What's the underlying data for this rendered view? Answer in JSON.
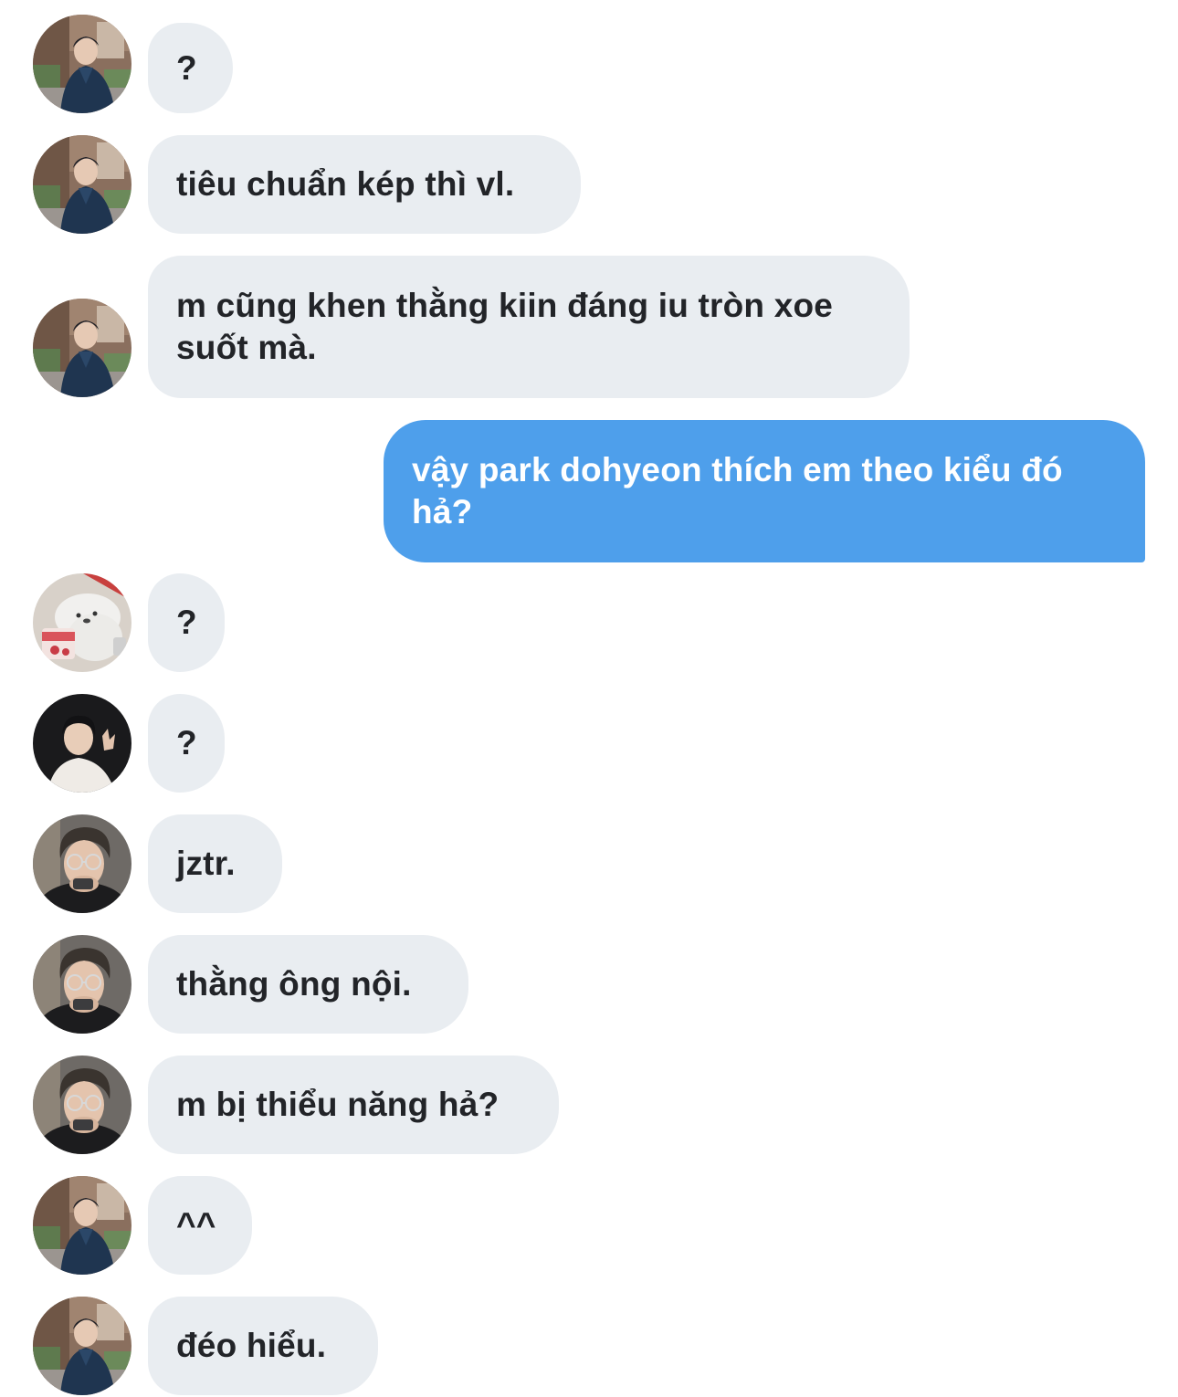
{
  "colors": {
    "incoming_bubble": "#e9edf1",
    "outgoing_bubble": "#4e9feb",
    "incoming_text": "#222428",
    "outgoing_text": "#ffffff",
    "background": "#ffffff"
  },
  "messages": [
    {
      "sender": "them",
      "avatar": "avatar-man-street",
      "text": "?"
    },
    {
      "sender": "them",
      "avatar": "avatar-man-street",
      "text": "tiêu chuẩn kép thì vl."
    },
    {
      "sender": "them",
      "avatar": "avatar-man-street",
      "text": "m cũng khen thằng kiin đáng iu tròn xoe\nsuốt mà."
    },
    {
      "sender": "me",
      "text": "vậy park dohyeon thích em theo kiểu đó\nhả?"
    },
    {
      "sender": "them",
      "avatar": "avatar-bear-icecream",
      "text": "?"
    },
    {
      "sender": "them",
      "avatar": "avatar-man-dark",
      "text": "?"
    },
    {
      "sender": "them",
      "avatar": "avatar-man-glasses",
      "text": "jztr."
    },
    {
      "sender": "them",
      "avatar": "avatar-man-glasses",
      "text": "thằng ông nội."
    },
    {
      "sender": "them",
      "avatar": "avatar-man-glasses",
      "text": "m bị thiểu năng hả?"
    },
    {
      "sender": "them",
      "avatar": "avatar-man-street",
      "text": "^^"
    },
    {
      "sender": "them",
      "avatar": "avatar-man-street",
      "text": "đéo hiểu."
    }
  ]
}
